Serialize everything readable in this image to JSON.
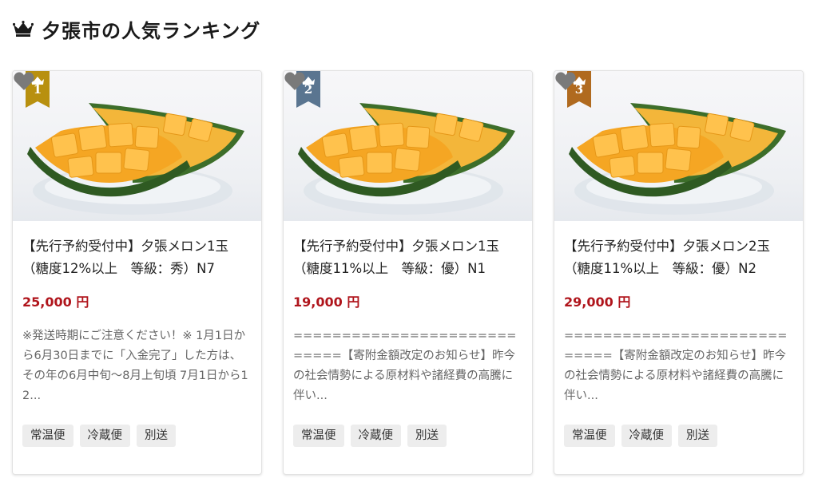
{
  "header": {
    "title": "夕張市の人気ランキング",
    "crown_icon": "crown-icon",
    "crown_color": "#1a1a1a"
  },
  "cards": [
    {
      "rank": "1",
      "rank_color": "#b8900f",
      "name_line1": "【先行予約受付中】夕張メロン1玉",
      "name_line2": "（糖度12%以上　等級：秀）N7",
      "price": "25,000 円",
      "desc": "※発送時期にご注意ください！※ 1月1日から6月30日までに「入金完了」した方は、その年の6月中旬～8月上旬頃 7月1日から12...",
      "tags": [
        "常温便",
        "冷蔵便",
        "別送"
      ],
      "image": "melon-slices-on-glass-plate",
      "fav_icon": "heart-icon"
    },
    {
      "rank": "2",
      "rank_color": "#5a7590",
      "name_line1": "【先行予約受付中】夕張メロン1玉",
      "name_line2": "（糖度11%以上　等級：優）N1",
      "price": "19,000 円",
      "desc": "============================【寄附金額改定のお知らせ】昨今の社会情勢による原材料や諸経費の高騰に伴い...",
      "tags": [
        "常温便",
        "冷蔵便",
        "別送"
      ],
      "image": "melon-slices-on-glass-plate",
      "fav_icon": "heart-icon"
    },
    {
      "rank": "3",
      "rank_color": "#b06a1f",
      "name_line1": "【先行予約受付中】夕張メロン2玉",
      "name_line2": "（糖度11%以上　等級：優）N2",
      "price": "29,000 円",
      "desc": "============================【寄附金額改定のお知らせ】昨今の社会情勢による原材料や諸経費の高騰に伴い...",
      "tags": [
        "常温便",
        "冷蔵便",
        "別送"
      ],
      "image": "melon-slices-on-glass-plate",
      "fav_icon": "heart-icon"
    }
  ],
  "price_color": "#b0151c"
}
